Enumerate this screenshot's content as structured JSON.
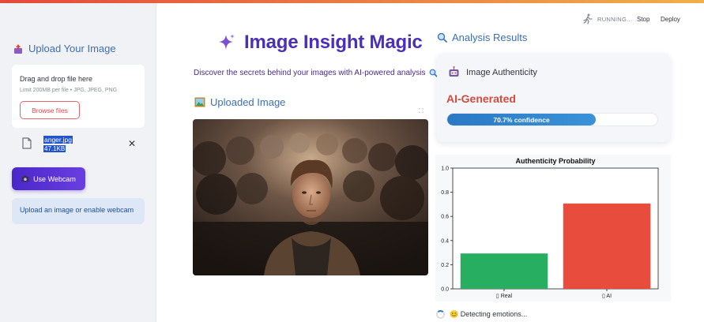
{
  "sidebar": {
    "title": "Upload Your Image",
    "uploader": {
      "drag_text": "Drag and drop file here",
      "limit_text": "Limit 200MB per file • JPG, JPEG, PNG",
      "browse_label": "Browse files"
    },
    "file": {
      "name": "anger.jpg",
      "size": "47.1KB",
      "close_glyph": "✕"
    },
    "webcam_label": "Use Webcam",
    "info_text": "Upload an image or enable webcam"
  },
  "header": {
    "running_text": "RUNNING...",
    "stop_label": "Stop",
    "deploy_label": "Deploy"
  },
  "main": {
    "title": "Image Insight Magic",
    "subtitle": "Discover the secrets behind your images with AI-powered analysis",
    "uploaded_title": "Uploaded Image"
  },
  "analysis": {
    "title": "Analysis Results",
    "card_title": "Image Authenticity",
    "result": "AI-Generated",
    "confidence_value": 0.707,
    "confidence_text": "70.7% confidence",
    "status_text": "😊 Detecting emotions..."
  },
  "colors": {
    "accent_purple": "#4930b8",
    "section_blue": "#3c6fb4",
    "result_red": "#d24b3c",
    "real_bar": "#27ae60",
    "ai_bar": "#e74c3c"
  },
  "chart_data": {
    "type": "bar",
    "title": "Authenticity Probability",
    "categories": [
      "▯ Real",
      "▯ AI"
    ],
    "values": [
      0.293,
      0.707
    ],
    "colors": [
      "#27ae60",
      "#e74c3c"
    ],
    "ylim": [
      0,
      1.0
    ],
    "yticks": [
      "0.0",
      "0.2",
      "0.4",
      "0.6",
      "0.8",
      "1.0"
    ],
    "xlabel": "",
    "ylabel": "",
    "grid": false
  }
}
